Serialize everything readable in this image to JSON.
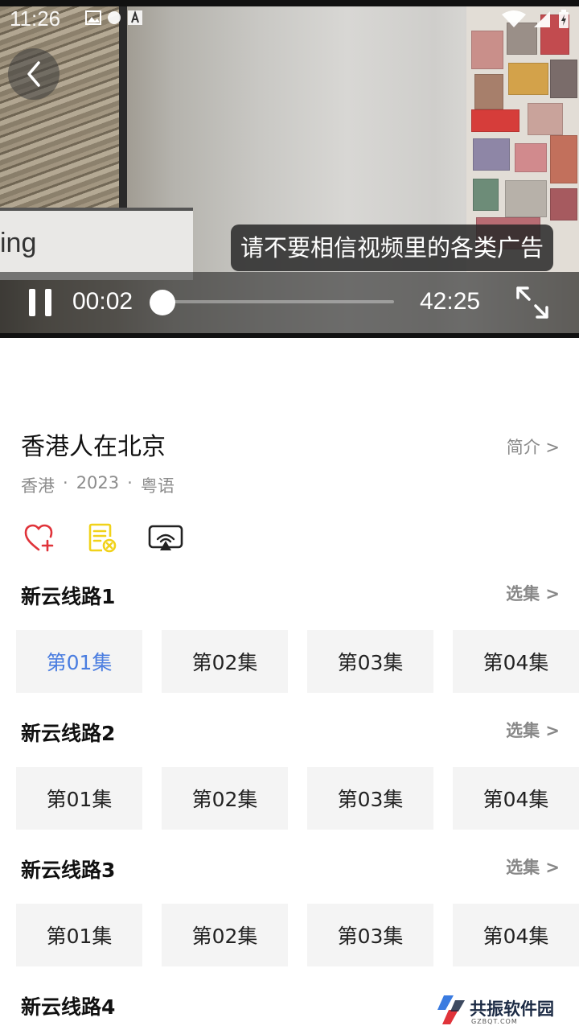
{
  "status_bar": {
    "time": "11:26"
  },
  "player": {
    "board_text": "ing",
    "notice": "请不要相信视频里的各类广告",
    "current_time": "00:02",
    "total_time": "42:25",
    "progress_fraction": 0.0008
  },
  "show": {
    "title": "香港人在北京",
    "intro_label": "简介 >",
    "region": "香港",
    "year": "2023",
    "language": "粤语"
  },
  "actions": [
    "heart-add-icon",
    "playlist-remove-icon",
    "cast-icon"
  ],
  "lines": [
    {
      "name": "新云线路1",
      "select_label": "选集 >",
      "episodes": [
        "第01集",
        "第02集",
        "第03集",
        "第04集"
      ],
      "active": 0
    },
    {
      "name": "新云线路2",
      "select_label": "选集 >",
      "episodes": [
        "第01集",
        "第02集",
        "第03集",
        "第04集"
      ]
    },
    {
      "name": "新云线路3",
      "select_label": "选集 >",
      "episodes": [
        "第01集",
        "第02集",
        "第03集",
        "第04集"
      ]
    },
    {
      "name": "新云线路4"
    }
  ],
  "watermark": {
    "text": "共振软件园",
    "sub": "GZBQT.COM"
  },
  "colors": {
    "accent": "#4a7de0",
    "heart": "#e0333a",
    "note": "#f1d21a",
    "cast": "#222222"
  }
}
